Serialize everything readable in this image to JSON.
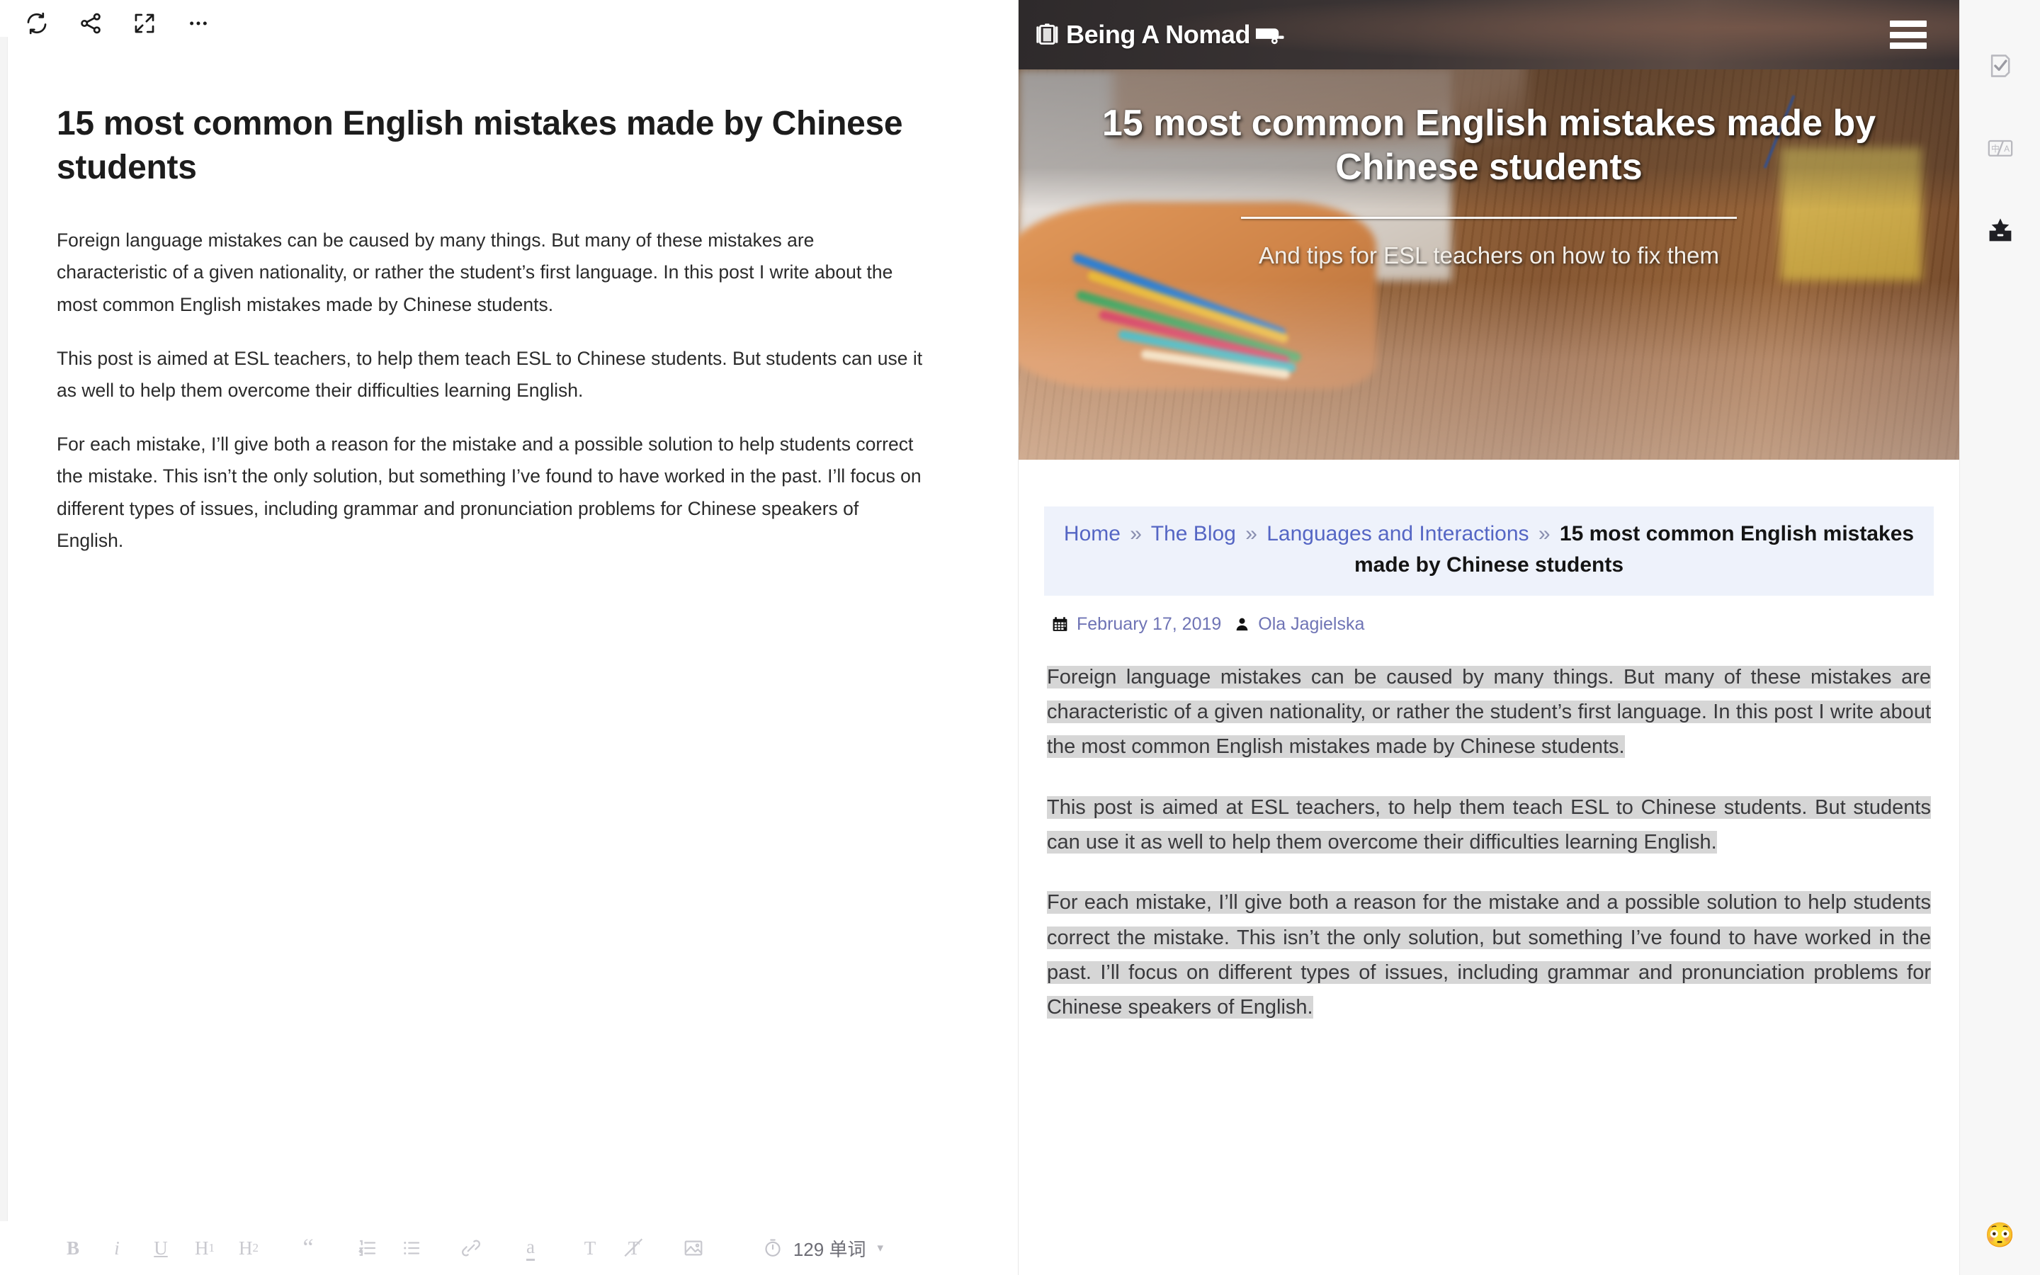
{
  "editor": {
    "toolbar_top": [
      {
        "name": "refresh-sync-icon",
        "label": "Sync"
      },
      {
        "name": "share-icon",
        "label": "Share"
      },
      {
        "name": "fullscreen-icon",
        "label": "Fullscreen"
      },
      {
        "name": "more-options-icon",
        "label": "More"
      }
    ],
    "document": {
      "title": "15 most common English mistakes made by Chinese students",
      "paragraphs": [
        "Foreign language mistakes can be caused by many things. But many of these mistakes are characteristic of a given nationality, or rather the student’s first language. In this post I write about the most common English mistakes made by Chinese students.",
        "This post is aimed at ESL teachers, to help them teach ESL to Chinese students. But students can use it as well to help them overcome their difficulties learning English.",
        "For each mistake, I’ll give both a reason for the mistake and a possible solution to help students correct the mistake. This isn’t the only solution, but something I’ve found to have worked in the past. I’ll focus on different types of issues, including grammar and pronunciation problems for Chinese speakers of English."
      ]
    },
    "format_toolbar": [
      {
        "name": "bold-button",
        "label": "B"
      },
      {
        "name": "italic-button",
        "label": "i"
      },
      {
        "name": "underline-button",
        "label": "U"
      },
      {
        "name": "heading-1-button",
        "label": "H1"
      },
      {
        "name": "heading-2-button",
        "label": "H2"
      },
      {
        "name": "blockquote-button",
        "label": "“"
      },
      {
        "name": "ordered-list-button",
        "label": "Ordered list"
      },
      {
        "name": "bullet-list-button",
        "label": "Bullet list"
      },
      {
        "name": "link-button",
        "label": "Link"
      },
      {
        "name": "highlight-button",
        "label": "a"
      },
      {
        "name": "text-color-button",
        "label": "T"
      },
      {
        "name": "clear-format-button",
        "label": "Clear format"
      },
      {
        "name": "insert-image-button",
        "label": "Image"
      }
    ],
    "word_count": {
      "icon": "timer-icon",
      "text": "129 单词",
      "caret": "▾"
    }
  },
  "web": {
    "site_logo": "Being A Nomad",
    "menu_icon": "hamburger-menu-icon",
    "hero": {
      "title": "15 most common English mistakes made by Chinese students",
      "subtitle": "And tips for ESL teachers on how to fix them"
    },
    "breadcrumb": {
      "items": [
        {
          "label": "Home",
          "current": false
        },
        {
          "label": "The Blog",
          "current": false
        },
        {
          "label": "Languages and Interactions",
          "current": false
        },
        {
          "label": "15 most common English mistakes made by Chinese students",
          "current": true
        }
      ],
      "separator": "»"
    },
    "meta": {
      "date_icon": "calendar-icon",
      "date": "February 17, 2019",
      "author_icon": "user-icon",
      "author": "Ola Jagielska"
    },
    "paragraphs": [
      "Foreign language mistakes can be caused by many things. But many of these mistakes are characteristic of a given nationality, or rather the student’s first language. In this post I write about the most common English mistakes made by Chinese students.",
      "This post is aimed at ESL teachers, to help them teach ESL to Chinese students. But students can use it as well to help them overcome their difficulties learning English.",
      "For each mistake, I’ll give both a reason for the mistake and a possible solution to help students correct the mistake. This isn’t the only solution, but something I’ve found to have worked in the past. I’ll focus on different types of issues, including grammar and pronunciation problems for Chinese speakers of English."
    ]
  },
  "rail": {
    "buttons": [
      {
        "name": "check-document-icon",
        "label": "Proofread"
      },
      {
        "name": "translate-icon",
        "label": "Translate"
      },
      {
        "name": "toolbox-icon",
        "label": "Toolbox"
      }
    ],
    "emoji": {
      "name": "emoji-face-icon",
      "label": "😳"
    }
  },
  "colors": {
    "accent_link": "#5566c4",
    "breadcrumb_bg": "#eef2fb",
    "selection_bg": "#d6d6d6",
    "header_bg": "#33302f",
    "rail_bg": "#f7f7f7"
  }
}
